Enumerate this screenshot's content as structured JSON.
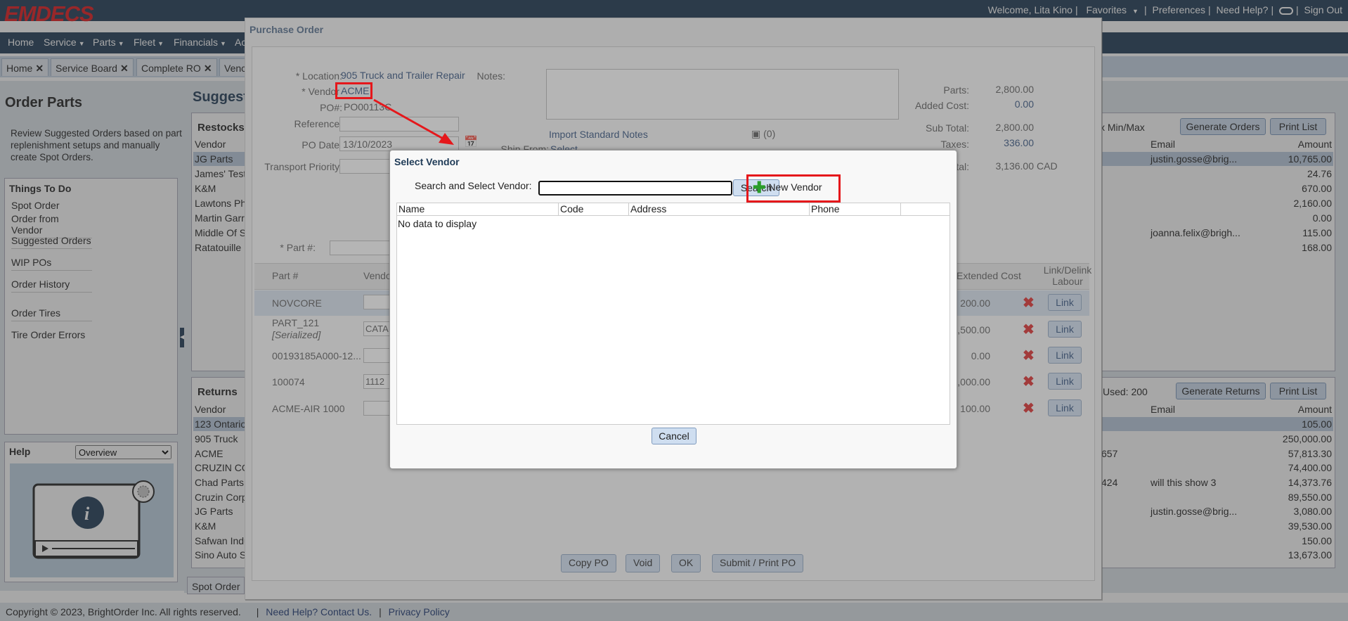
{
  "app": {
    "logo": "EMDECS",
    "welcome": "Welcome, Lita Kino",
    "top_links": [
      "Favorites",
      "Preferences",
      "Need Help?",
      "Sign Out"
    ]
  },
  "nav": [
    "Home",
    "Service",
    "Parts",
    "Fleet",
    "Financials",
    "Ac"
  ],
  "tabs": [
    "Home",
    "Service Board",
    "Complete RO",
    "Venc"
  ],
  "left": {
    "title": "Order Parts",
    "description": "Review Suggested Orders based on part replenishment setups and manually create Spot Orders.",
    "things_title": "Things To Do",
    "things": [
      "Spot Order",
      "Order from Vendor",
      "Suggested Orders",
      "WIP POs",
      "Order History",
      "Order Tires",
      "Tire Order Errors"
    ],
    "help_title": "Help",
    "help_select": "Overview"
  },
  "main": {
    "title": "Suggeste",
    "restocks": {
      "title": "Restocks",
      "col_vendor": "Vendor",
      "vendors": [
        "JG Parts",
        "James' Test",
        "K&M",
        "Lawtons Ph",
        "Martin Garr",
        "Middle Of S",
        "Ratatouille"
      ],
      "minmax": "x Min/Max",
      "col_email": "Email",
      "col_amount": "Amount",
      "emails": [
        "justin.gosse@brig...",
        "",
        "",
        "",
        "",
        "joanna.felix@brigh...",
        ""
      ],
      "amounts": [
        "10,765.00",
        "24.76",
        "670.00",
        "2,160.00",
        "0.00",
        "115.00",
        "168.00"
      ],
      "btn_generate": "Generate Orders",
      "btn_print": "Print List"
    },
    "returns": {
      "title": "Returns",
      "col_vendor": "Vendor",
      "vendors": [
        "123 Ontario",
        "905 Truck",
        "ACME",
        "CRUZIN CO",
        "Chad Parts",
        "Cruzin Corp",
        "JG Parts",
        "K&M",
        "Safwan Indu",
        "Sino Auto S"
      ],
      "used": "Used:  200",
      "col_email": "Email",
      "col_amount": "Amount",
      "mid": [
        "",
        "",
        "657",
        "",
        "424",
        "",
        "",
        "",
        "",
        ""
      ],
      "emails": [
        "",
        "",
        "",
        "",
        "will this show 3",
        "",
        "justin.gosse@brig...",
        "",
        "",
        ""
      ],
      "amounts": [
        "105.00",
        "250,000.00",
        "57,813.30",
        "74,400.00",
        "14,373.76",
        "89,550.00",
        "3,080.00",
        "39,530.00",
        "150.00",
        "13,673.00"
      ],
      "btn_generate": "Generate Returns",
      "btn_print": "Print List"
    },
    "spot_tab": "Spot Order"
  },
  "footer": {
    "copyright": "Copyright © 2023, BrightOrder Inc. All rights reserved.",
    "help_link": "Need Help? Contact Us.",
    "privacy": "Privacy Policy"
  },
  "po": {
    "title": "Purchase Order",
    "location_label": "* Location:",
    "location": "905 Truck and Trailer Repair",
    "vendor_label": "* Vendor",
    "vendor": "ACME",
    "po_label": "PO#:",
    "po_number": "PO00113C",
    "reference_label": "Reference:",
    "podate_label": "PO Date:",
    "podate": "13/10/2023",
    "transport_label": "Transport Priority:",
    "notes_label": "Notes:",
    "import_notes": "Import Standard Notes",
    "attach_count": "(0)",
    "ship_from": "Ship From:",
    "ship_select": "Select",
    "parts_label": "Parts:",
    "parts": "2,800.00",
    "added_label": "Added Cost:",
    "added": "0.00",
    "subtotal_label": "Sub Total:",
    "subtotal": "2,800.00",
    "taxes_label": "Taxes:",
    "taxes": "336.00",
    "total_label": "Total:",
    "total": "3,136.00",
    "currency": "CAD",
    "partnum_label": "* Part #:",
    "col_part": "Part #",
    "col_vendor": "Vendo",
    "col_extended": "Extended Cost",
    "col_link": "Link/Delink Labour",
    "rows": [
      {
        "part": "NOVCORE",
        "serial": "",
        "vendor": "",
        "cost": "200.00",
        "link": "Link"
      },
      {
        "part": "PART_121",
        "serial": "[Serialized]",
        "vendor": "CATA",
        "cost": "1,500.00",
        "link": "Link"
      },
      {
        "part": "00193185A000-12...",
        "serial": "",
        "vendor": "",
        "cost": "0.00",
        "link": "Link"
      },
      {
        "part": "100074",
        "serial": "",
        "vendor": "1112",
        "cost": "1,000.00",
        "link": "Link"
      },
      {
        "part": "ACME-AIR 1000",
        "serial": "",
        "vendor": "",
        "cost": "100.00",
        "link": "Link"
      }
    ],
    "btn_copy": "Copy PO",
    "btn_void": "Void",
    "btn_ok": "OK",
    "btn_submit": "Submit / Print PO"
  },
  "modal": {
    "title": "Select Vendor",
    "search_label": "Search and Select Vendor:",
    "search_value": "",
    "search_btn": "Search",
    "new_vendor": "New Vendor",
    "cols": [
      "Name",
      "Code",
      "Address",
      "Phone"
    ],
    "empty": "No data to display",
    "cancel": "Cancel"
  },
  "colors": {
    "brand_red": "#e5171b",
    "navy": "#1f3b57",
    "annotation": "#e5171b"
  }
}
